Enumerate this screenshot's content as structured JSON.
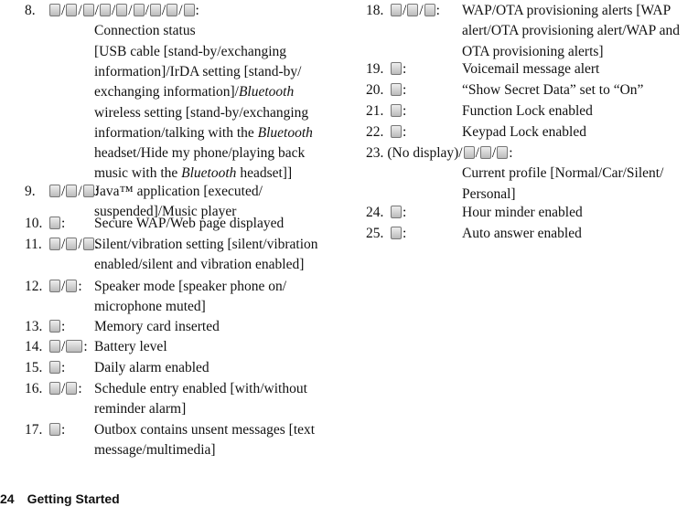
{
  "left": [
    {
      "num": "8.",
      "icons": [
        "usb-icon",
        "usb-exchange-icon",
        "irda-icon",
        "irda-exchange-icon",
        "bluetooth-icon",
        "bluetooth-exchange-icon",
        "headset-talking-icon",
        "hide-phone-icon",
        "bluetooth-music-icon"
      ],
      "desc_next_line": true,
      "lines": [
        [
          "Connection status"
        ],
        [
          "[USB cable [stand-by/exchanging"
        ],
        [
          "information]/IrDA setting [stand-by/"
        ],
        [
          "exchanging information]/",
          {
            "i": "Bluetooth"
          }
        ],
        [
          "wireless setting [stand-by/exchanging"
        ],
        [
          "information/talking with the ",
          {
            "i": "Bluetooth"
          }
        ],
        [
          "headset/Hide my phone/playing back"
        ],
        [
          "music with the ",
          {
            "i": "Bluetooth"
          },
          " headset]]"
        ]
      ]
    },
    {
      "num": "9.",
      "icons": [
        "java-executed-icon",
        "java-suspended-icon",
        "music-player-icon"
      ],
      "lines": [
        [
          "Java™ application [executed/"
        ],
        [
          "suspended]/Music player"
        ]
      ]
    },
    {
      "num": "10.",
      "icons": [
        "secure-web-icon"
      ],
      "lines": [
        [
          "Secure WAP/Web page displayed"
        ]
      ]
    },
    {
      "num": "11.",
      "icons": [
        "silent-icon",
        "vibration-icon",
        "silent-vibration-icon"
      ],
      "lines": [
        [
          "Silent/vibration setting [silent/vibration"
        ],
        [
          "enabled/silent and vibration enabled]"
        ]
      ]
    },
    {
      "num": "12.",
      "icons": [
        "speaker-phone-icon",
        "microphone-muted-icon"
      ],
      "lines": [
        [
          "Speaker mode [speaker phone on/"
        ],
        [
          "microphone muted]"
        ]
      ]
    },
    {
      "num": "13.",
      "icons": [
        "memory-card-icon"
      ],
      "lines": [
        [
          "Memory card inserted"
        ]
      ]
    },
    {
      "num": "14.",
      "icons": [
        "battery-icon",
        "battery-full-icon"
      ],
      "lines": [
        [
          "Battery level"
        ]
      ]
    },
    {
      "num": "15.",
      "icons": [
        "daily-alarm-icon"
      ],
      "lines": [
        [
          "Daily alarm enabled"
        ]
      ]
    },
    {
      "num": "16.",
      "icons": [
        "schedule-alarm-icon",
        "schedule-icon"
      ],
      "lines": [
        [
          "Schedule entry enabled [with/without"
        ],
        [
          "reminder alarm]"
        ]
      ]
    },
    {
      "num": "17.",
      "icons": [
        "outbox-icon"
      ],
      "lines": [
        [
          "Outbox contains unsent messages [text"
        ],
        [
          "message/multimedia]"
        ]
      ]
    }
  ],
  "right": [
    {
      "num": "18.",
      "icons": [
        "wap-alert-icon",
        "ota-alert-icon",
        "wap-ota-alert-icon"
      ],
      "lines": [
        [
          "WAP/OTA provisioning alerts [WAP"
        ],
        [
          "alert/OTA provisioning alert/WAP and"
        ],
        [
          "OTA provisioning alerts]"
        ]
      ]
    },
    {
      "num": "19.",
      "icons": [
        "voicemail-icon"
      ],
      "lines": [
        [
          "Voicemail message alert"
        ]
      ]
    },
    {
      "num": "20.",
      "icons": [
        "secret-data-icon"
      ],
      "lines": [
        [
          "“Show Secret Data” set to “On”"
        ]
      ]
    },
    {
      "num": "21.",
      "icons": [
        "function-lock-icon"
      ],
      "lines": [
        [
          "Function Lock enabled"
        ]
      ]
    },
    {
      "num": "22.",
      "icons": [
        "keypad-lock-icon"
      ],
      "lines": [
        [
          "Keypad Lock enabled"
        ]
      ]
    },
    {
      "num": "23.",
      "prefix": "(No display)/",
      "icons": [
        "car-profile-icon",
        "silent-profile-icon",
        "personal-profile-icon"
      ],
      "desc_next_line": true,
      "lines": [
        [
          "Current profile [Normal/Car/Silent/"
        ],
        [
          "Personal]"
        ]
      ]
    },
    {
      "num": "24.",
      "icons": [
        "hour-minder-icon"
      ],
      "lines": [
        [
          "Hour minder enabled"
        ]
      ]
    },
    {
      "num": "25.",
      "icons": [
        "auto-answer-icon"
      ],
      "lines": [
        [
          "Auto answer enabled"
        ]
      ]
    }
  ],
  "footer": {
    "page": "24",
    "section": "Getting Started"
  }
}
